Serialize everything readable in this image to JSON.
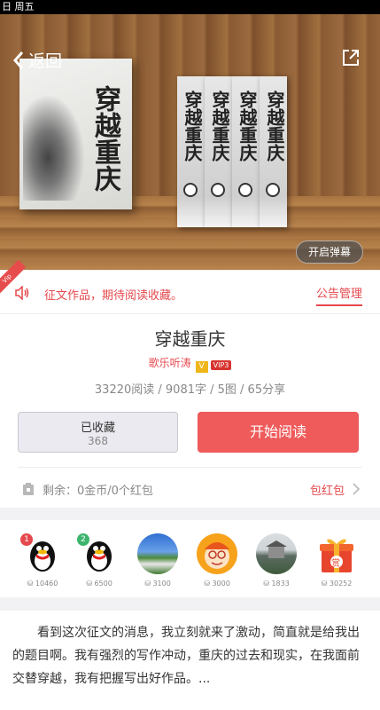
{
  "status_bar": {
    "text": "日 周五"
  },
  "nav": {
    "back_label": "返回"
  },
  "hero": {
    "cover_title": "穿越重庆",
    "danmu_label": "开启弹幕"
  },
  "notice": {
    "ribbon": "Vip",
    "text": "征文作品，期待阅读收藏。",
    "manage_label": "公告管理"
  },
  "book": {
    "title": "穿越重庆",
    "author": "歌乐听涛",
    "v_badge": "V",
    "vip_badge": "VIP3",
    "stats": "33220阅读 / 9081字 / 5图 / 65分享"
  },
  "actions": {
    "fav_label": "已收藏",
    "fav_count": "368",
    "read_label": "开始阅读"
  },
  "wallet": {
    "remaining": "剩余：0金币/0个红包",
    "redbag_label": "包红包"
  },
  "donors": [
    {
      "amount": "10460",
      "type": "qq-penguin",
      "badge": "1"
    },
    {
      "amount": "6500",
      "type": "qq-penguin",
      "badge": "2"
    },
    {
      "amount": "3100",
      "type": "landscape"
    },
    {
      "amount": "3000",
      "type": "cartoon"
    },
    {
      "amount": "1833",
      "type": "building"
    },
    {
      "amount": "30252",
      "type": "gift",
      "badge_text": "赏"
    }
  ],
  "excerpt": {
    "text": "看到这次征文的消息，我立刻就来了激动，简直就是给我出的题目啊。我有强烈的写作冲动，重庆的过去和现实，在我面前交替穿越，我有把握写出好作品。..."
  }
}
